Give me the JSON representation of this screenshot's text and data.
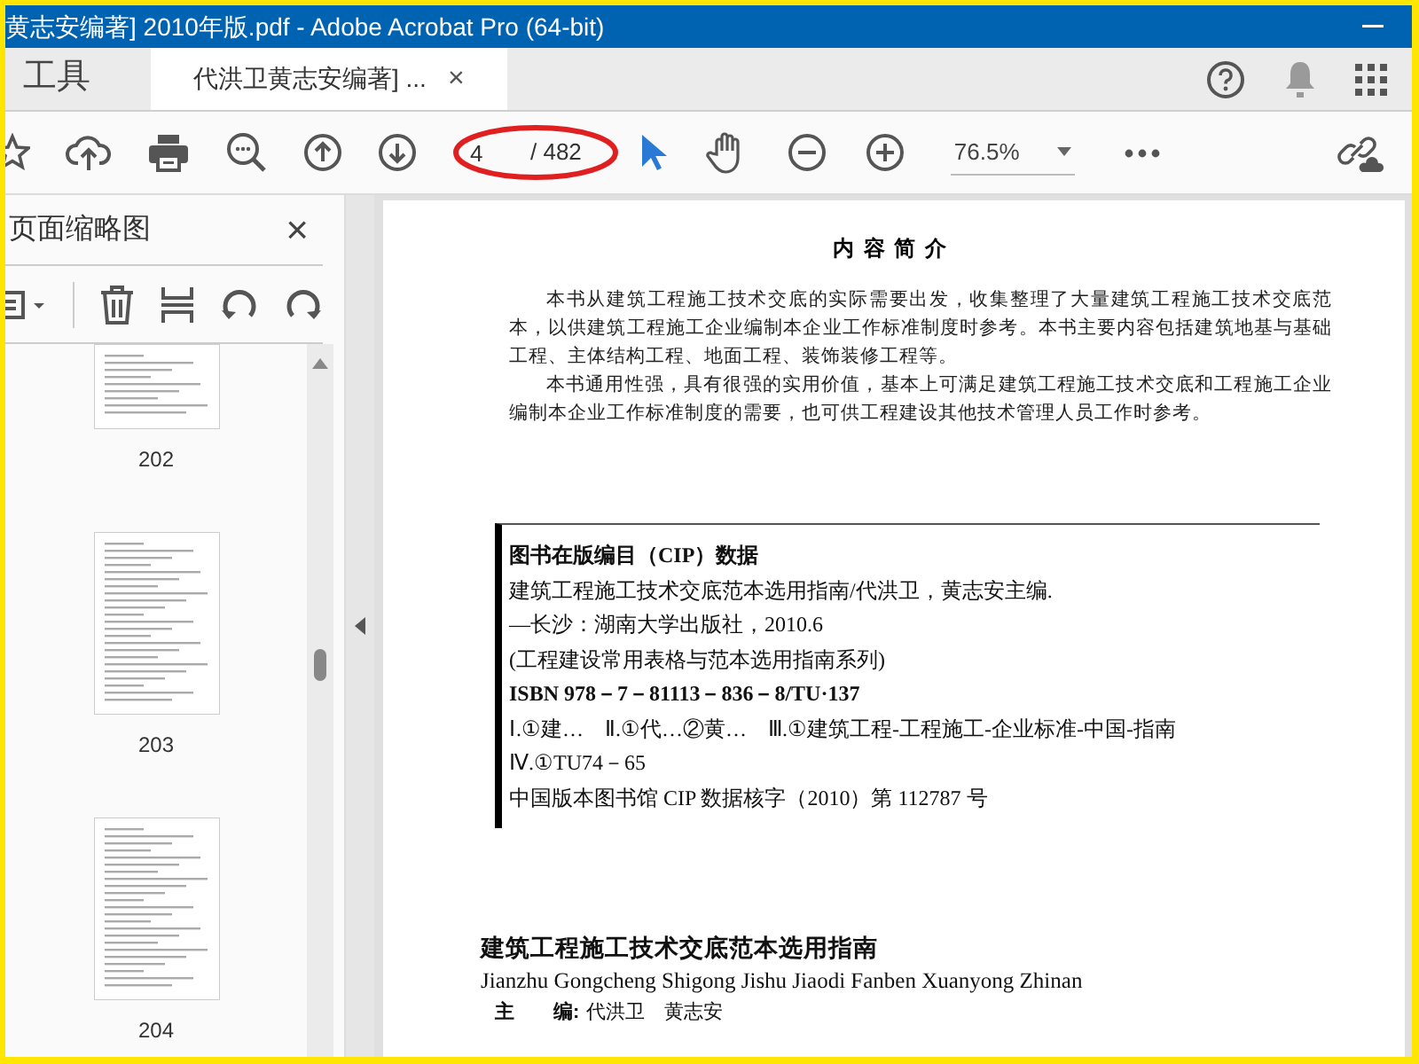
{
  "window": {
    "title": "黄志安编著] 2010年版.pdf - Adobe Acrobat Pro (64-bit)"
  },
  "tabs": [
    {
      "label": "工具",
      "selected": false
    },
    {
      "label": "代洪卫黄志安编著] ...",
      "selected": true,
      "close": "×"
    }
  ],
  "toolbar": {
    "page_input": "4",
    "page_total": "/ 482",
    "zoom": "76.5%"
  },
  "sidebar": {
    "title": "页面缩略图",
    "close": "×",
    "thumbnails": [
      {
        "label": "202"
      },
      {
        "label": "203"
      },
      {
        "label": "204"
      }
    ]
  },
  "document": {
    "heading": "内 容 简 介",
    "paragraphs": [
      "本书从建筑工程施工技术交底的实际需要出发，收集整理了大量建筑工程施工技术交底范本，以供建筑工程施工企业编制本企业工作标准制度时参考。本书主要内容包括建筑地基与基础工程、主体结构工程、地面工程、装饰装修工程等。",
      "本书通用性强，具有很强的实用价值，基本上可满足建筑工程施工技术交底和工程施工企业编制本企业工作标准制度的需要，也可供工程建设其他技术管理人员工作时参考。"
    ],
    "cip_lines": [
      {
        "text": "图书在版编目（CIP）数据",
        "kind": "bold"
      },
      {
        "text": "建筑工程施工技术交底范本选用指南/代洪卫，黄志安主编.",
        "kind": "plain"
      },
      {
        "text": "—长沙：湖南大学出版社，2010.6",
        "kind": "plain"
      },
      {
        "text": "(工程建设常用表格与范本选用指南系列)",
        "kind": "plain"
      },
      {
        "text": "ISBN 978－7－81113－836－8/TU·137",
        "kind": "bold"
      },
      {
        "text": "Ⅰ.①建…　Ⅱ.①代…②黄…　Ⅲ.①建筑工程-工程施工-企业标准-中国-指南",
        "kind": "plain"
      },
      {
        "text": "Ⅳ.①TU74－65",
        "kind": "plain"
      },
      {
        "text": "中国版本图书馆 CIP 数据核字（2010）第 112787 号",
        "kind": "plain"
      }
    ],
    "book_title": "建筑工程施工技术交底范本选用指南",
    "book_pinyin": "Jianzhu Gongcheng Shigong Jishu Jiaodi Fanben Xuanyong Zhinan",
    "editor_label": "主　　编:",
    "editor_value": "代洪卫　黄志安"
  }
}
